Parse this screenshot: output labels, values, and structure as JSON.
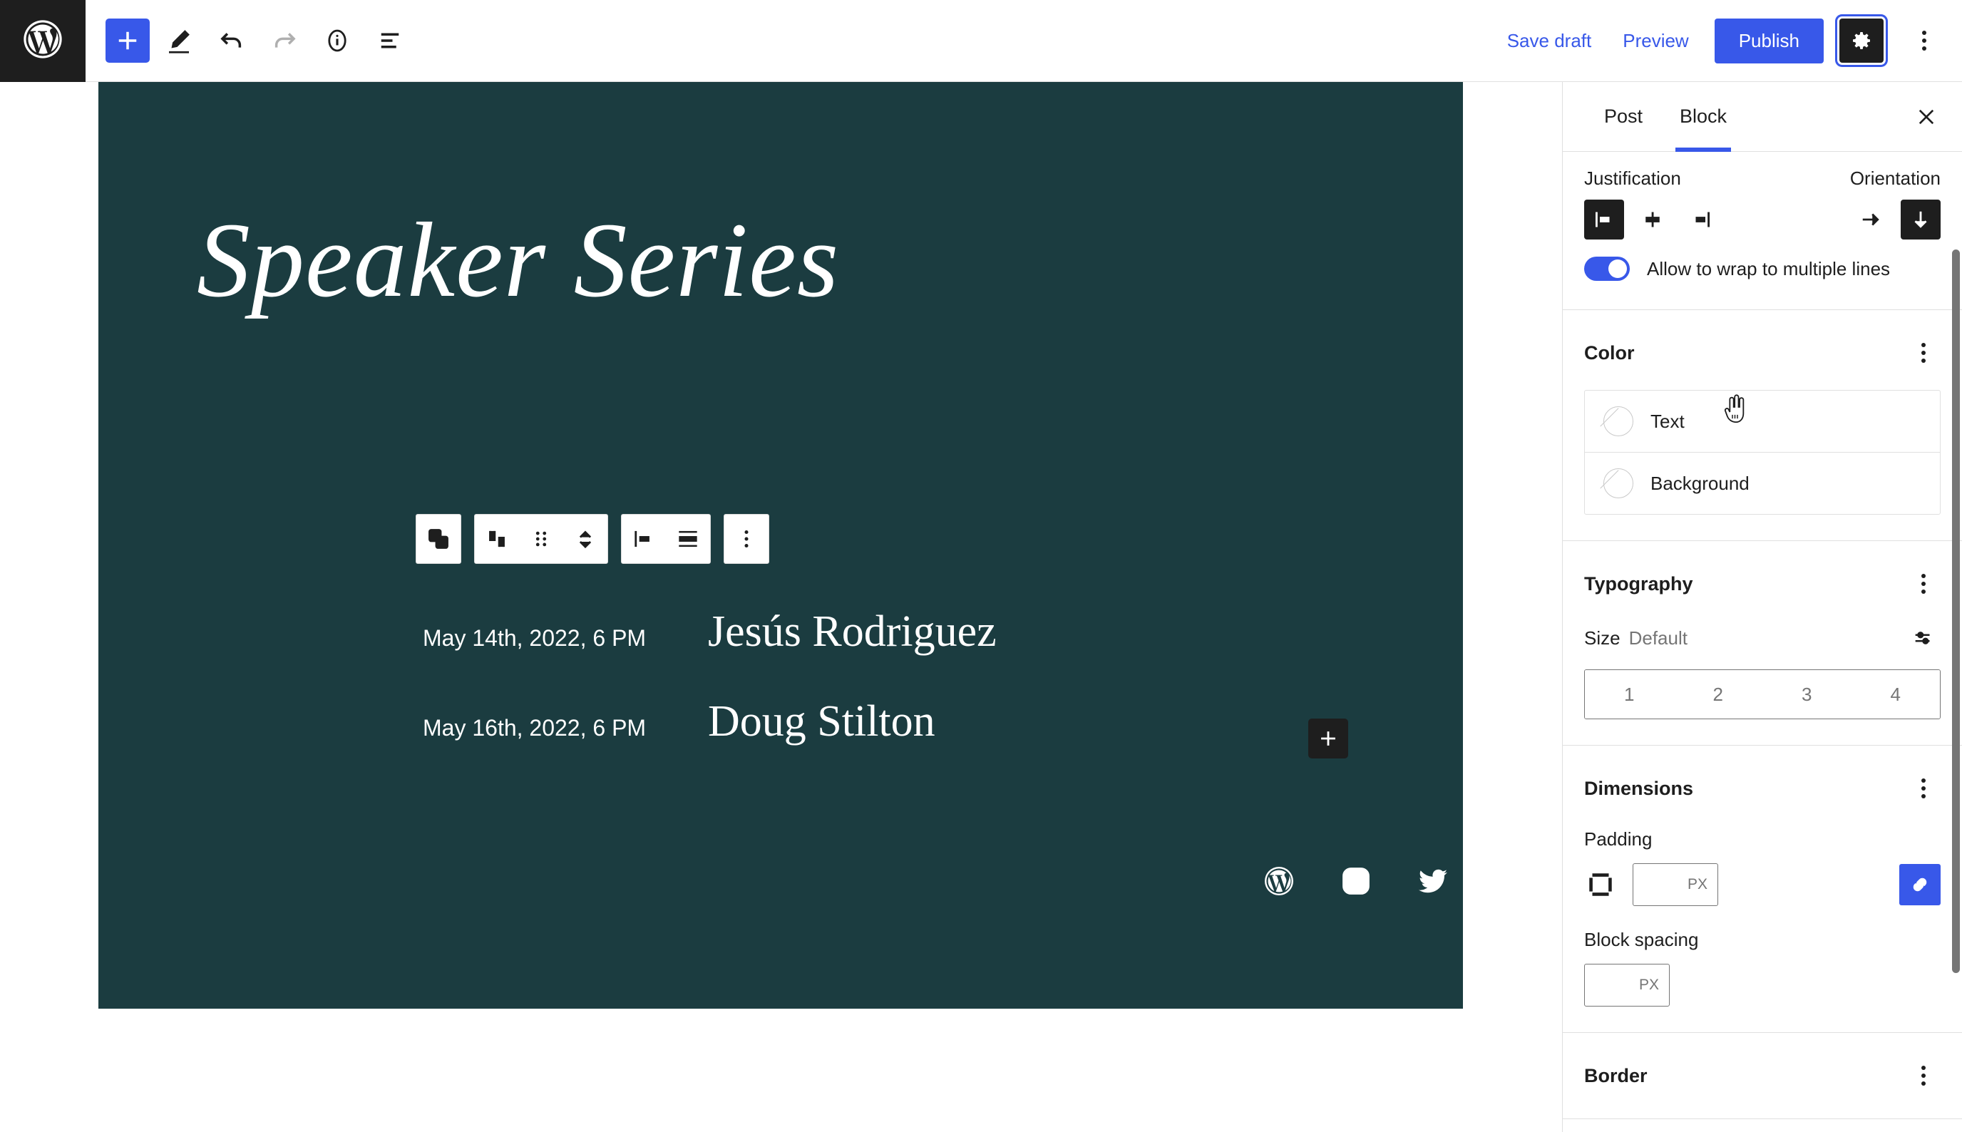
{
  "topbar": {
    "logo_icon": "wordpress-logo-icon",
    "tools": [
      {
        "name": "add-block-button",
        "icon": "plus-icon",
        "label": "Add block",
        "primary": true
      },
      {
        "name": "tools-pencil-button",
        "icon": "pencil-icon",
        "label": "Tools"
      },
      {
        "name": "undo-button",
        "icon": "undo-icon",
        "label": "Undo"
      },
      {
        "name": "redo-button",
        "icon": "redo-icon",
        "label": "Redo",
        "disabled": true
      },
      {
        "name": "details-info-button",
        "icon": "info-icon",
        "label": "Details"
      },
      {
        "name": "list-view-button",
        "icon": "list-view-icon",
        "label": "List View"
      }
    ],
    "save_draft_label": "Save draft",
    "preview_label": "Preview",
    "publish_label": "Publish",
    "settings_icon": "gear-icon",
    "options_icon": "kebab-menu-icon"
  },
  "canvas": {
    "background_color": "#1b3c40",
    "title": "Speaker Series",
    "block_toolbar": {
      "block_type_icon": "group-block-icon",
      "transform_icon": "row-transform-icon",
      "drag_icon": "drag-handle-icon",
      "move_up_icon": "chevron-up-icon",
      "move_down_icon": "chevron-down-icon",
      "justify_icon": "justify-left-icon",
      "align_icon": "vertical-align-center-icon",
      "more_icon": "kebab-menu-icon"
    },
    "schedule": [
      {
        "date": "May 14th, 2022, 6 PM",
        "speaker": "Jesús Rodriguez"
      },
      {
        "date": "May 16th, 2022, 6 PM",
        "speaker": "Doug Stilton"
      }
    ],
    "inserter_icon": "plus-icon",
    "social_links": [
      {
        "name": "wordpress",
        "icon": "wordpress-icon"
      },
      {
        "name": "instagram",
        "icon": "instagram-icon"
      },
      {
        "name": "twitter",
        "icon": "twitter-icon"
      }
    ]
  },
  "sidebar": {
    "tabs": [
      {
        "label": "Post",
        "active": false
      },
      {
        "label": "Block",
        "active": true
      }
    ],
    "close_icon": "close-icon",
    "layout": {
      "justification_label": "Justification",
      "orientation_label": "Orientation",
      "justification_options": [
        {
          "name": "justify-left",
          "icon": "justify-left-icon",
          "active": true
        },
        {
          "name": "justify-center",
          "icon": "justify-center-icon",
          "active": false
        },
        {
          "name": "justify-right",
          "icon": "justify-right-icon",
          "active": false
        }
      ],
      "orientation_options": [
        {
          "name": "horizontal",
          "icon": "arrow-right-icon",
          "active": false
        },
        {
          "name": "vertical",
          "icon": "arrow-down-icon",
          "active": true
        }
      ],
      "wrap_label": "Allow to wrap to multiple lines",
      "wrap_enabled": true
    },
    "color": {
      "title": "Color",
      "options_icon": "kebab-menu-icon",
      "items": [
        {
          "label": "Text",
          "value": null
        },
        {
          "label": "Background",
          "value": null
        }
      ]
    },
    "typography": {
      "title": "Typography",
      "options_icon": "kebab-menu-icon",
      "size_label": "Size",
      "size_value": "Default",
      "size_settings_icon": "sliders-icon",
      "size_steps": [
        "1",
        "2",
        "3",
        "4"
      ]
    },
    "dimensions": {
      "title": "Dimensions",
      "options_icon": "kebab-menu-icon",
      "padding_label": "Padding",
      "padding_icon": "padding-box-icon",
      "padding_value": "",
      "padding_unit": "PX",
      "link_sides_icon": "link-icon",
      "link_sides_active": true,
      "block_spacing_label": "Block spacing",
      "block_spacing_value": "",
      "block_spacing_unit": "PX"
    },
    "border": {
      "title": "Border",
      "options_icon": "kebab-menu-icon"
    }
  },
  "colors": {
    "accent": "#3858e9",
    "dark": "#1e1e1e",
    "canvas_teal": "#1b3c40",
    "muted": "#757575"
  }
}
